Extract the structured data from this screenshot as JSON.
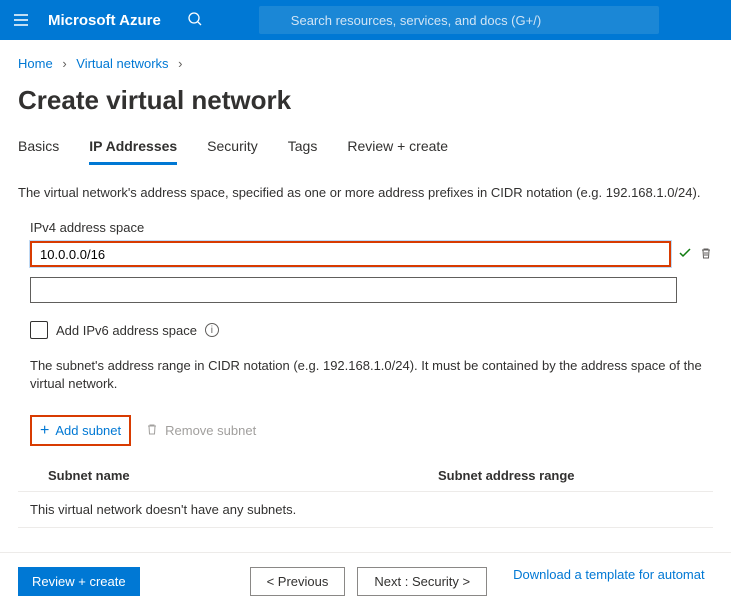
{
  "header": {
    "brand": "Microsoft Azure",
    "search_placeholder": "Search resources, services, and docs (G+/)"
  },
  "breadcrumb": {
    "home": "Home",
    "vnets": "Virtual networks"
  },
  "page_title": "Create virtual network",
  "tabs": {
    "basics": "Basics",
    "ip": "IP Addresses",
    "security": "Security",
    "tags": "Tags",
    "review": "Review + create"
  },
  "ip_section": {
    "description": "The virtual network's address space, specified as one or more address prefixes in CIDR notation (e.g. 192.168.1.0/24).",
    "label_ipv4": "IPv4 address space",
    "input1_value": "10.0.0.0/16",
    "input2_value": "",
    "checkbox_label": "Add IPv6 address space",
    "subnet_description": "The subnet's address range in CIDR notation (e.g. 192.168.1.0/24). It must be contained by the address space of the virtual network.",
    "add_subnet_label": "Add subnet",
    "remove_subnet_label": "Remove subnet",
    "col_name": "Subnet name",
    "col_range": "Subnet address range",
    "empty_msg": "This virtual network doesn't have any subnets."
  },
  "footer": {
    "review": "Review + create",
    "prev": "< Previous",
    "next": "Next : Security >",
    "download": "Download a template for automat"
  }
}
